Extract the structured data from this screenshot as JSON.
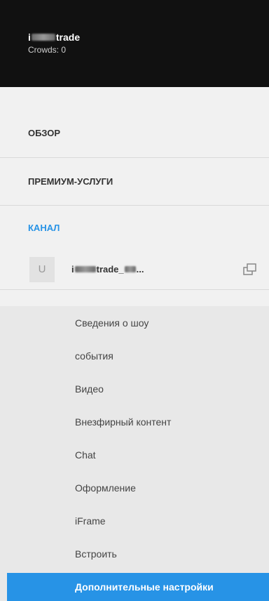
{
  "header": {
    "username_prefix": "i",
    "username_suffix": "trade",
    "crowds": "Crowds: 0"
  },
  "nav": {
    "overview": "ОБЗОР",
    "premium": "ПРЕМИУМ-УСЛУГИ",
    "channel": "КАНАЛ"
  },
  "channel": {
    "avatar_letter": "U",
    "name_prefix": "i",
    "name_middle": "trade_",
    "name_suffix": "..."
  },
  "submenu": [
    {
      "label": "Сведения о шоу"
    },
    {
      "label": "события"
    },
    {
      "label": "Видео"
    },
    {
      "label": "Внезфирный контент"
    },
    {
      "label": "Chat"
    },
    {
      "label": "Оформление"
    },
    {
      "label": "iFrame"
    },
    {
      "label": "Встроить"
    },
    {
      "label": "Дополнительные настройки"
    }
  ],
  "colors": {
    "accent": "#2793e6",
    "header_bg": "#111111",
    "sidebar_bg": "#f1f1f1"
  },
  "icons": {
    "switch": "switch-channel-icon"
  }
}
